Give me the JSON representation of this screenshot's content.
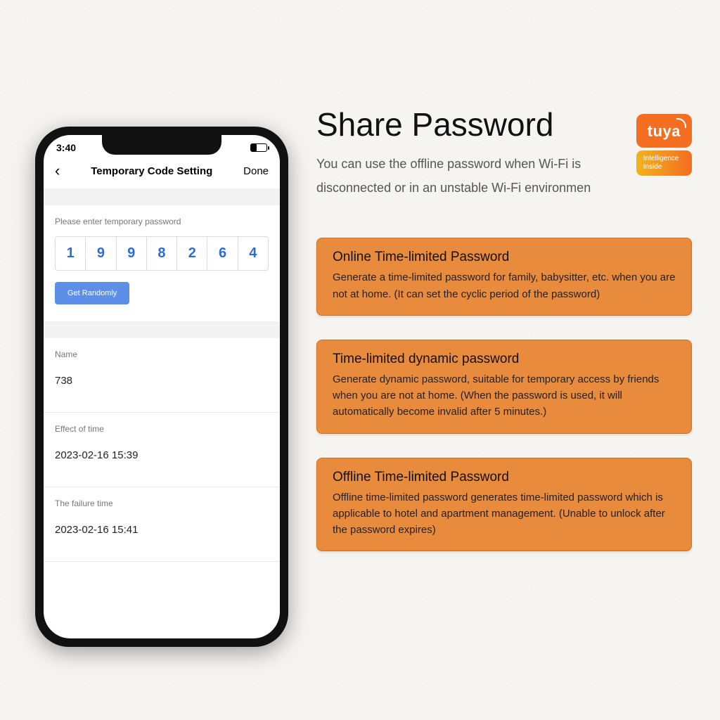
{
  "phone": {
    "status_time": "3:40",
    "nav": {
      "title": "Temporary Code Setting",
      "done": "Done"
    },
    "prompt": "Please enter temporary password",
    "digits": [
      "1",
      "9",
      "9",
      "8",
      "2",
      "6",
      "4"
    ],
    "random_button": "Get Randomly",
    "fields": {
      "name_label": "Name",
      "name_value": "738",
      "effect_label": "Effect of time",
      "effect_value": "2023-02-16 15:39",
      "failure_label": "The failure time",
      "failure_value": "2023-02-16 15:41"
    }
  },
  "headline": "Share Password",
  "subtext": "You can use the offline password when Wi-Fi is disconnected or in an unstable Wi-Fi environmen",
  "logo": {
    "brand": "tuya",
    "tag_line1": "Intelligence",
    "tag_line2": "Inside"
  },
  "cards": [
    {
      "title": "Online Time-limited Password",
      "body": "Generate a time-limited password for family, babysitter, etc. when you are not at home.  (It can set the cyclic period of the password)"
    },
    {
      "title": "Time-limited dynamic password",
      "body": "Generate dynamic password, suitable for temporary access by friends when you are not at home. (When the password is used, it will automatically become invalid after 5 minutes.)"
    },
    {
      "title": "Offline Time-limited Password",
      "body": "Offline time-limited password generates time-limited password which is applicable to hotel and apartment management. (Unable to unlock after the password expires)"
    }
  ]
}
